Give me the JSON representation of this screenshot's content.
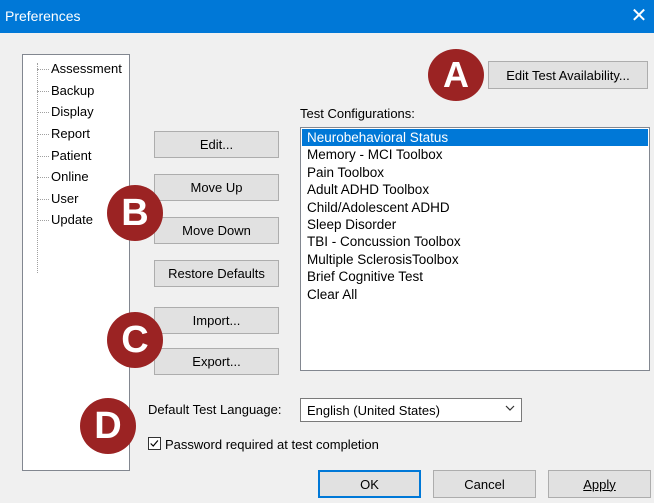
{
  "window": {
    "title": "Preferences",
    "close_glyph": "✕"
  },
  "tree": {
    "items": [
      {
        "label": "Assessment"
      },
      {
        "label": "Backup"
      },
      {
        "label": "Display"
      },
      {
        "label": "Report"
      },
      {
        "label": "Patient"
      },
      {
        "label": "Online"
      },
      {
        "label": "User"
      },
      {
        "label": "Update"
      }
    ]
  },
  "buttons": {
    "edit_availability": "Edit Test Availability...",
    "edit": "Edit...",
    "move_up": "Move Up",
    "move_down": "Move Down",
    "restore_defaults": "Restore Defaults",
    "import": "Import...",
    "export": "Export...",
    "ok": "OK",
    "cancel": "Cancel",
    "apply": "Apply"
  },
  "configs": {
    "label": "Test Configurations:",
    "items": [
      "Neurobehavioral Status",
      "Memory - MCI Toolbox",
      "Pain Toolbox",
      "Adult ADHD Toolbox",
      "Child/Adolescent ADHD",
      "Sleep Disorder",
      "TBI - Concussion Toolbox",
      "Multiple SclerosisToolbox",
      "Brief Cognitive Test",
      "Clear All"
    ],
    "selected": "Neurobehavioral Status"
  },
  "language": {
    "label": "Default Test Language:",
    "value": "English (United States)"
  },
  "password": {
    "label": "Password required at test completion",
    "checked": true
  },
  "badges": {
    "a": "A",
    "b": "B",
    "c": "C",
    "d": "D"
  },
  "colors": {
    "titlebar": "#0078d7",
    "selection": "#0078d7",
    "badge": "#9b2323"
  }
}
